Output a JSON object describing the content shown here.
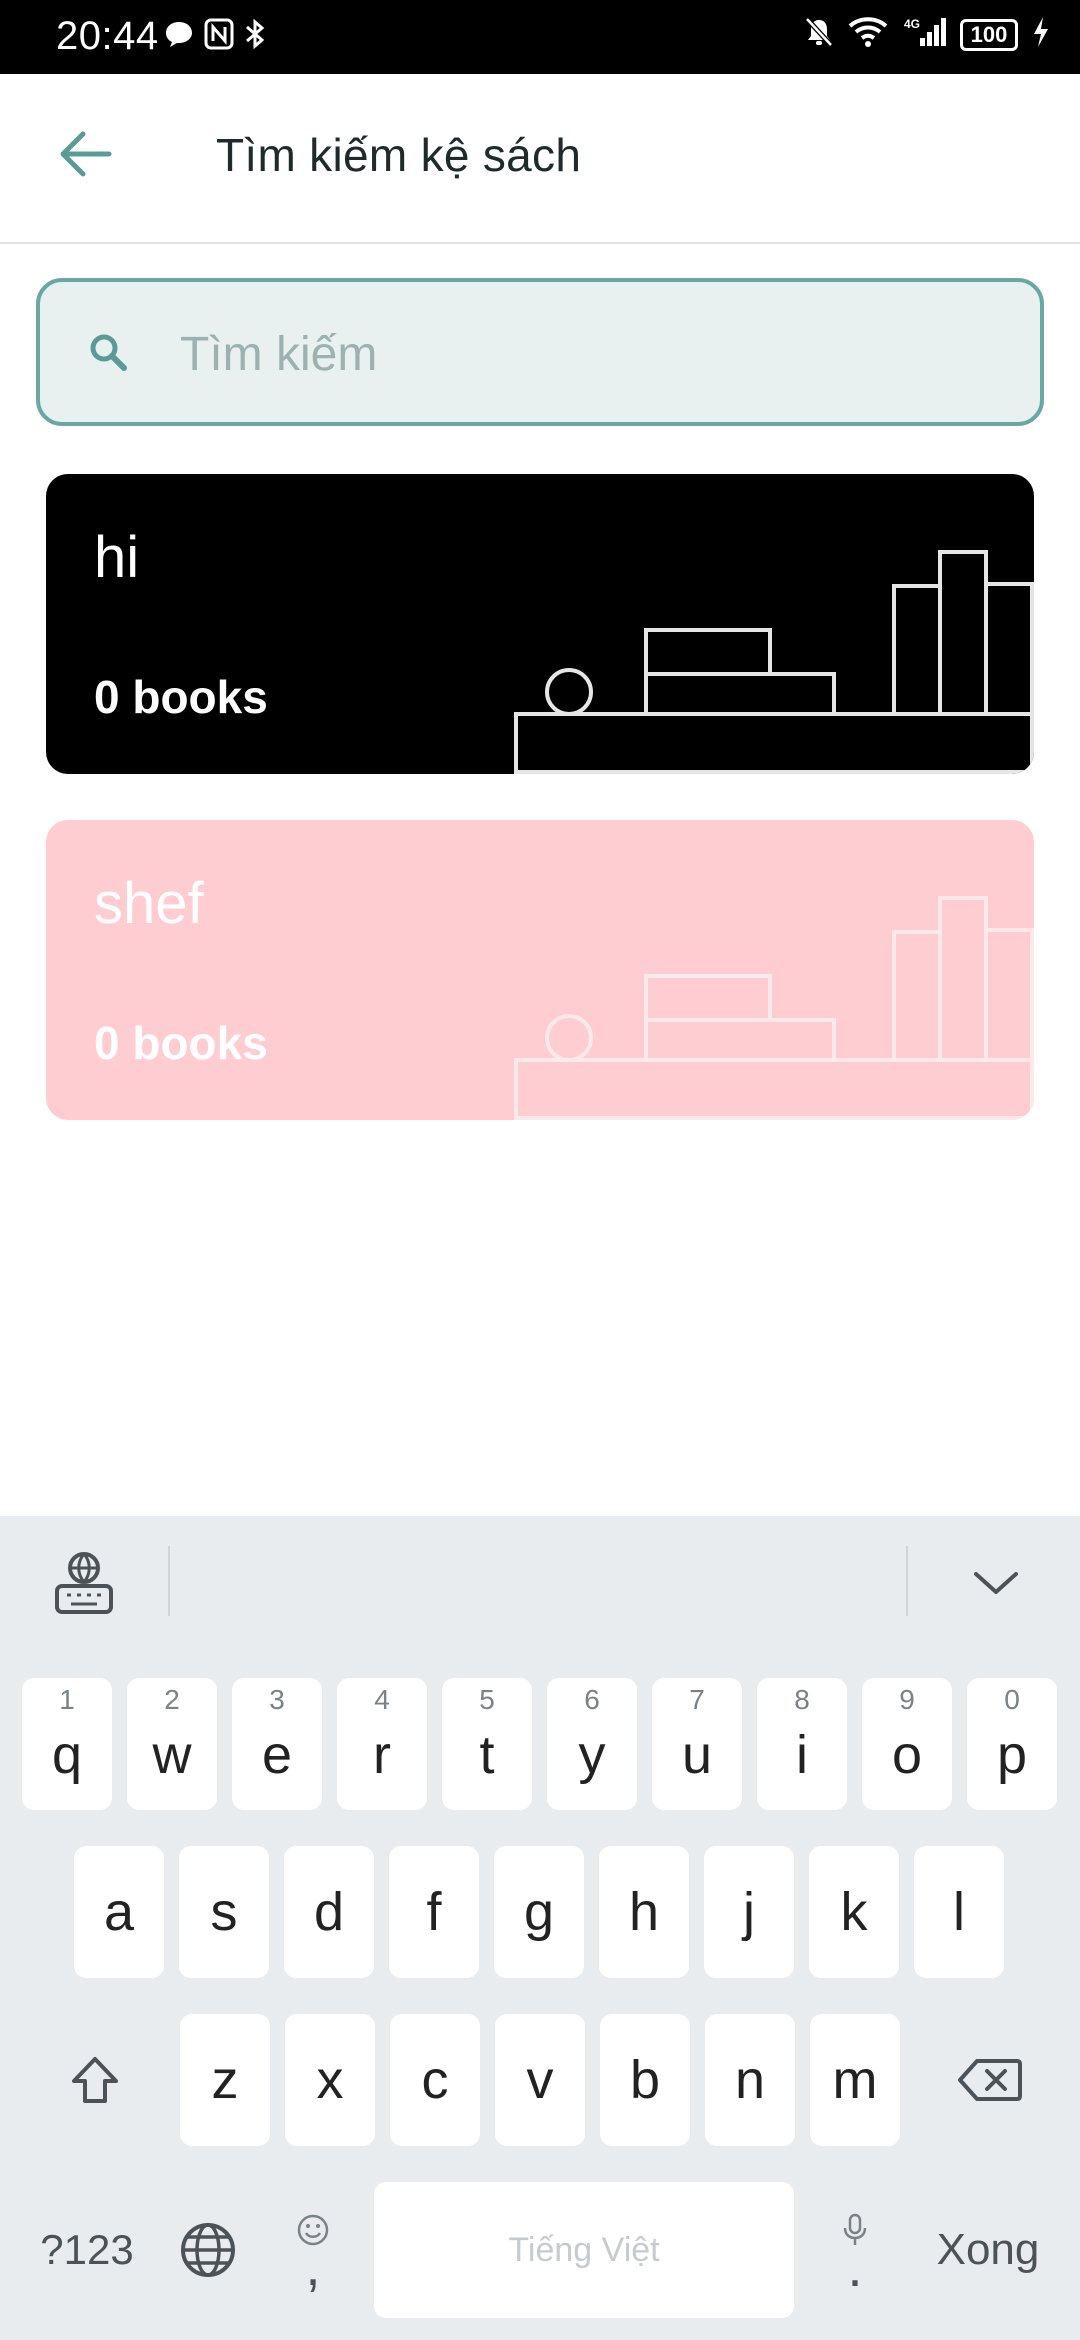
{
  "status_bar": {
    "time": "20:44",
    "battery": "100",
    "network": "4G"
  },
  "app_bar": {
    "title": "Tìm kiếm kệ sách"
  },
  "search": {
    "placeholder": "Tìm kiếm",
    "value": ""
  },
  "shelves": [
    {
      "name": "hi",
      "count": "0 books",
      "color": "#000000"
    },
    {
      "name": "shef",
      "count": "0 books",
      "color": "#fecdd2"
    }
  ],
  "keyboard": {
    "row1": [
      {
        "ch": "q",
        "num": "1"
      },
      {
        "ch": "w",
        "num": "2"
      },
      {
        "ch": "e",
        "num": "3"
      },
      {
        "ch": "r",
        "num": "4"
      },
      {
        "ch": "t",
        "num": "5"
      },
      {
        "ch": "y",
        "num": "6"
      },
      {
        "ch": "u",
        "num": "7"
      },
      {
        "ch": "i",
        "num": "8"
      },
      {
        "ch": "o",
        "num": "9"
      },
      {
        "ch": "p",
        "num": "0"
      }
    ],
    "row2": [
      "a",
      "s",
      "d",
      "f",
      "g",
      "h",
      "j",
      "k",
      "l"
    ],
    "row3": [
      "z",
      "x",
      "c",
      "v",
      "b",
      "n",
      "m"
    ],
    "symbols_label": "?123",
    "comma_label": ",",
    "period_label": ".",
    "space_label": "Tiếng Việt",
    "done_label": "Xong"
  }
}
